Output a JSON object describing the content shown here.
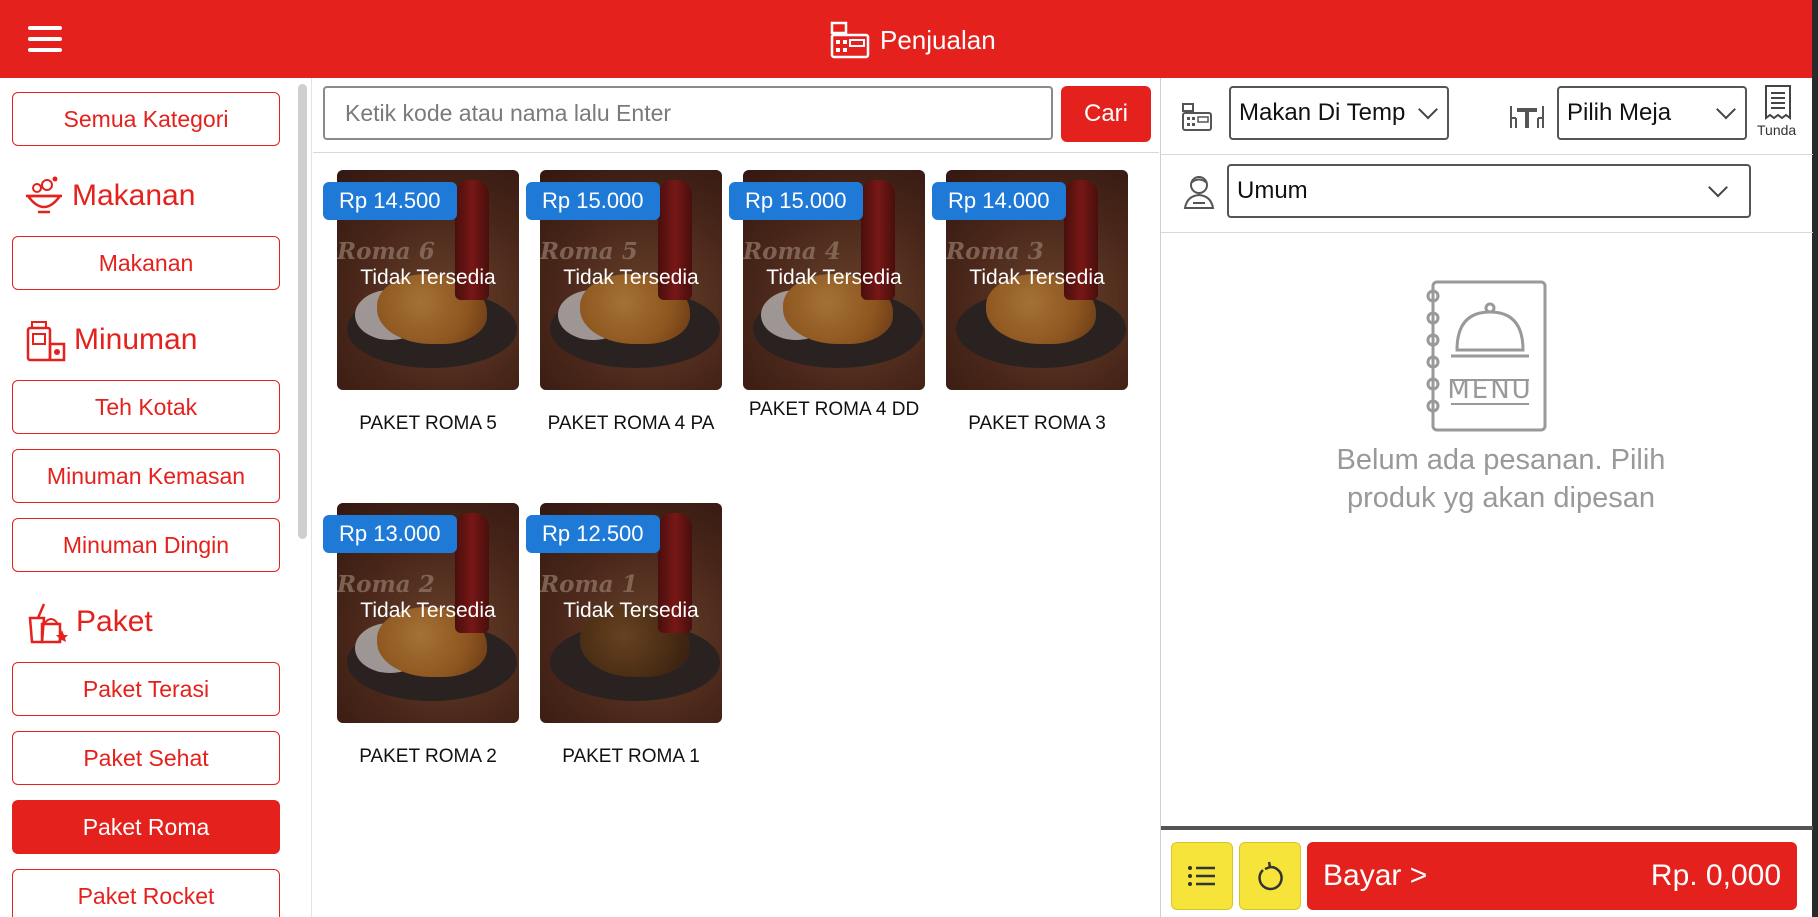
{
  "header": {
    "title": "Penjualan",
    "menu_icon": "hamburger-icon",
    "title_icon": "cash-register-icon"
  },
  "colors": {
    "primary": "#e4211c",
    "price_badge": "#1e7ad6",
    "footer_button": "#f6e43a"
  },
  "sidebar": {
    "all_label": "Semua Kategori",
    "groups": [
      {
        "name": "Makanan",
        "icon": "food-bowl-icon",
        "items": [
          "Makanan"
        ]
      },
      {
        "name": "Minuman",
        "icon": "drink-icon",
        "items": [
          "Teh Kotak",
          "Minuman Kemasan",
          "Minuman Dingin"
        ]
      },
      {
        "name": "Paket",
        "icon": "package-meal-icon",
        "items": [
          "Paket Terasi",
          "Paket Sehat",
          "Paket Roma",
          "Paket Rocket"
        ]
      }
    ],
    "active_item": "Paket Roma"
  },
  "search": {
    "placeholder": "Ketik kode atau nama lalu Enter",
    "button_label": "Cari"
  },
  "products": [
    {
      "price": "Rp 14.500",
      "name": "PAKET ROMA 5",
      "watermark": "Roma 6",
      "status": "Tidak Tersedia"
    },
    {
      "price": "Rp 15.000",
      "name": "PAKET ROMA 4 PA",
      "watermark": "Roma 5",
      "status": "Tidak Tersedia"
    },
    {
      "price": "Rp 15.000",
      "name": "PAKET ROMA 4 DD",
      "watermark": "Roma 4",
      "status": "Tidak Tersedia"
    },
    {
      "price": "Rp 14.000",
      "name": "PAKET ROMA 3",
      "watermark": "Roma 3",
      "status": "Tidak Tersedia"
    },
    {
      "price": "Rp 13.000",
      "name": "PAKET ROMA 2",
      "watermark": "Roma 2",
      "status": "Tidak Tersedia"
    },
    {
      "price": "Rp 12.500",
      "name": "PAKET ROMA 1",
      "watermark": "Roma 1",
      "status": "Tidak Tersedia"
    }
  ],
  "order": {
    "order_type": "Makan Di Temp",
    "table": "Pilih Meja",
    "tunda_label": "Tunda",
    "customer": "Umum",
    "empty_message": "Belum ada pesanan. Pilih produk yg akan dipesan",
    "menu_icon_text": "MENU",
    "pay_label": "Bayar >",
    "total": "Rp. 0,000"
  }
}
